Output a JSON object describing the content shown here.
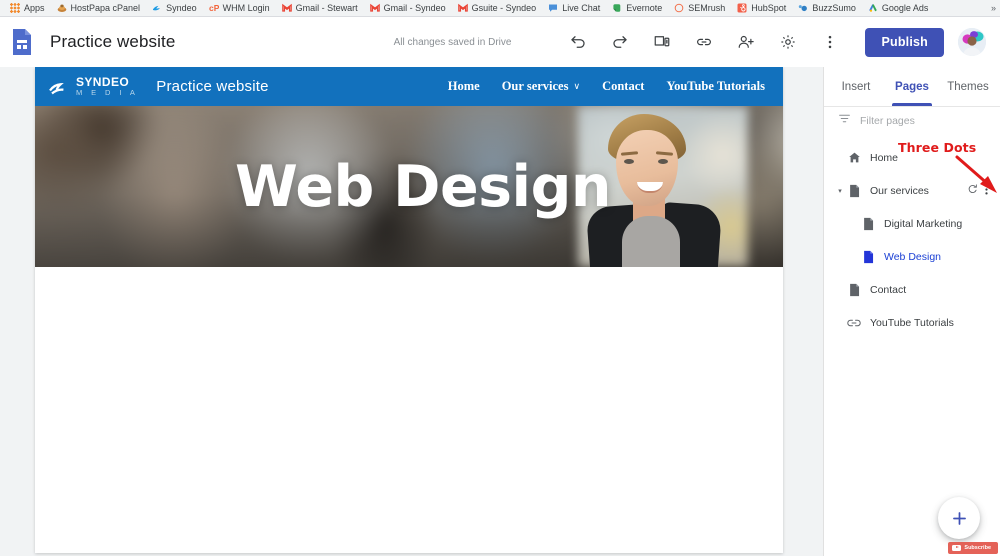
{
  "browser": {
    "bookmarks": [
      {
        "label": "Apps",
        "icon": "apps-grid-icon"
      },
      {
        "label": "HostPapa cPanel",
        "icon": "hostpapa-icon"
      },
      {
        "label": "Syndeo",
        "icon": "syndeo-icon"
      },
      {
        "label": "WHM Login",
        "icon": "whm-icon"
      },
      {
        "label": "Gmail - Stewart",
        "icon": "gmail-icon"
      },
      {
        "label": "Gmail - Syndeo",
        "icon": "gmail-icon"
      },
      {
        "label": "Gsuite - Syndeo",
        "icon": "gmail-icon"
      },
      {
        "label": "Live Chat",
        "icon": "livechat-icon"
      },
      {
        "label": "Evernote",
        "icon": "evernote-icon"
      },
      {
        "label": "SEMrush",
        "icon": "semrush-icon"
      },
      {
        "label": "HubSpot",
        "icon": "hubspot-icon"
      },
      {
        "label": "BuzzSumo",
        "icon": "buzzsumo-icon"
      },
      {
        "label": "Google Ads",
        "icon": "googleads-icon"
      }
    ],
    "overflow_label": "»"
  },
  "toolbar": {
    "app_icon": "google-sites-icon",
    "doc_title": "Practice website",
    "save_status": "All changes saved in Drive",
    "actions": [
      {
        "name": "undo-button",
        "label": "Undo"
      },
      {
        "name": "redo-button",
        "label": "Redo"
      },
      {
        "name": "preview-button",
        "label": "Preview"
      },
      {
        "name": "copy-link-button",
        "label": "Copy page link"
      },
      {
        "name": "share-button",
        "label": "Add editors"
      },
      {
        "name": "settings-button",
        "label": "Settings"
      },
      {
        "name": "more-options-button",
        "label": "More"
      }
    ],
    "publish_label": "Publish",
    "avatar_label": "Account"
  },
  "site_preview": {
    "logo_name": "SYNDEO",
    "logo_sub": "M E D I A",
    "site_name": "Practice website",
    "nav": [
      {
        "label": "Home",
        "has_caret": false
      },
      {
        "label": "Our services",
        "has_caret": true
      },
      {
        "label": "Contact",
        "has_caret": false
      },
      {
        "label": "YouTube Tutorials",
        "has_caret": false
      }
    ],
    "caret_glyph": "∨",
    "hero_title": "Web Design",
    "header_color": "#1271bd"
  },
  "panel": {
    "tabs": [
      {
        "label": "Insert",
        "active": false
      },
      {
        "label": "Pages",
        "active": true
      },
      {
        "label": "Themes",
        "active": false
      }
    ],
    "filter": {
      "placeholder": "Filter pages",
      "value": "",
      "icon": "filter-icon"
    },
    "pages": [
      {
        "label": "Home",
        "icon": "home-icon",
        "indent": false,
        "caret": "",
        "selected": false,
        "actions": false
      },
      {
        "label": "Our services",
        "icon": "page-icon",
        "indent": false,
        "caret": "▾",
        "selected": false,
        "actions": true
      },
      {
        "label": "Digital Marketing",
        "icon": "page-icon",
        "indent": true,
        "caret": "",
        "selected": false,
        "actions": false
      },
      {
        "label": "Web Design",
        "icon": "page-icon-blue",
        "indent": true,
        "caret": "",
        "selected": true,
        "actions": false
      },
      {
        "label": "Contact",
        "icon": "page-icon",
        "indent": false,
        "caret": "",
        "selected": false,
        "actions": false
      },
      {
        "label": "YouTube Tutorials",
        "icon": "link-icon",
        "indent": false,
        "caret": "",
        "selected": false,
        "actions": false
      }
    ],
    "annotation": {
      "text": "Three Dots",
      "color": "#e01b1b"
    },
    "fab_label": "+",
    "subscribe_label": "Subscribe"
  },
  "colors": {
    "accent": "#3f51b5",
    "site_blue": "#1271bd",
    "selected_page": "#1a3fd4",
    "annotation_red": "#e01b1b",
    "subscribe_red": "#e2574c"
  }
}
